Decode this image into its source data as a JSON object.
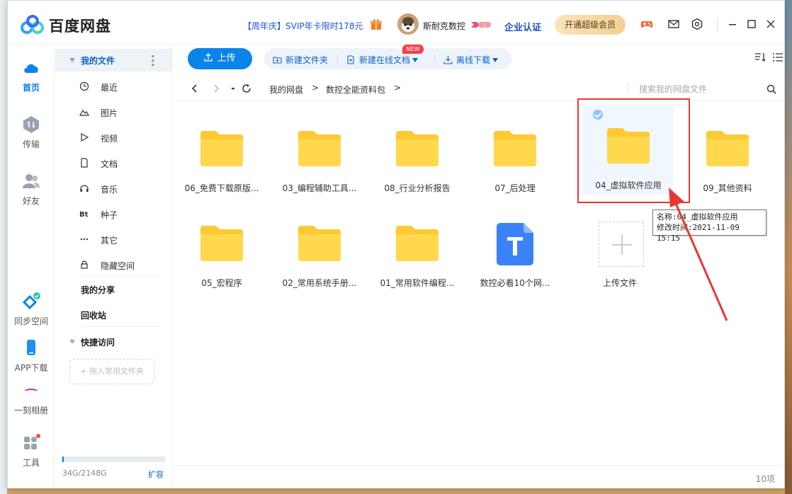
{
  "app": {
    "title": "百度网盘",
    "promo": "【周年庆】SVIP年卡限时178元",
    "username": "斯耐克数控",
    "enterprise": "企业认证",
    "svip_button": "开通超级会员"
  },
  "rail": {
    "items": [
      {
        "label": "首页",
        "icon": "cloud-icon",
        "active": true
      },
      {
        "label": "传输",
        "icon": "transfer-icon"
      },
      {
        "label": "好友",
        "icon": "friends-icon"
      },
      {
        "label": "同步空间",
        "icon": "sync-icon"
      },
      {
        "label": "APP下载",
        "icon": "phone-icon"
      },
      {
        "label": "一刻相册",
        "icon": "album-icon"
      },
      {
        "label": "工具",
        "icon": "tools-icon"
      }
    ]
  },
  "sidebar": {
    "my_files": "我的文件",
    "items": [
      {
        "label": "最近",
        "icon": "clock-icon"
      },
      {
        "label": "图片",
        "icon": "image-icon"
      },
      {
        "label": "视频",
        "icon": "play-icon"
      },
      {
        "label": "文档",
        "icon": "document-icon"
      },
      {
        "label": "音乐",
        "icon": "headphones-icon"
      },
      {
        "label": "种子",
        "icon": "bt-icon"
      },
      {
        "label": "其它",
        "icon": "more-icon"
      },
      {
        "label": "隐藏空间",
        "icon": "lock-icon"
      }
    ],
    "my_share": "我的分享",
    "recycle": "回收站",
    "quick_access": "快捷访问",
    "drag_hint": "+ 拖入常用文件夹",
    "storage_text": "34G/2148G",
    "storage_fraction": 0.0158,
    "expand": "扩容"
  },
  "toolbar": {
    "upload": "上传",
    "new_folder": "新建文件夹",
    "new_online_doc": "新建在线文档",
    "new_badge": "NEW",
    "offline_download": "离线下载"
  },
  "breadcrumb": {
    "items": [
      "我的网盘",
      "数控全能资料包"
    ],
    "separator": ">"
  },
  "search": {
    "placeholder": "搜索我的网盘文件"
  },
  "files": [
    {
      "name": "06_免费下载原版...",
      "type": "folder"
    },
    {
      "name": "03_编程辅助工具...",
      "type": "folder"
    },
    {
      "name": "08_行业分析报告",
      "type": "folder"
    },
    {
      "name": "07_后处理",
      "type": "folder"
    },
    {
      "name": "04_虚拟软件应用",
      "type": "folder",
      "selected": true
    },
    {
      "name": "09_其他资料",
      "type": "folder"
    },
    {
      "name": "05_宏程序",
      "type": "folder"
    },
    {
      "name": "02_常用系统手册...",
      "type": "folder"
    },
    {
      "name": "01_常用软件编程...",
      "type": "folder"
    },
    {
      "name": "数控必看10个网...",
      "type": "doc"
    },
    {
      "name": "上传文件",
      "type": "upload"
    }
  ],
  "tooltip": {
    "line1": "名称:04_虚拟软件应用",
    "line2": "修改时间:2021-11-09 15:15"
  },
  "footer": {
    "count": "10项"
  },
  "colors": {
    "accent": "#0a84ea",
    "folder": "#ffd043",
    "highlight": "#e53935"
  }
}
